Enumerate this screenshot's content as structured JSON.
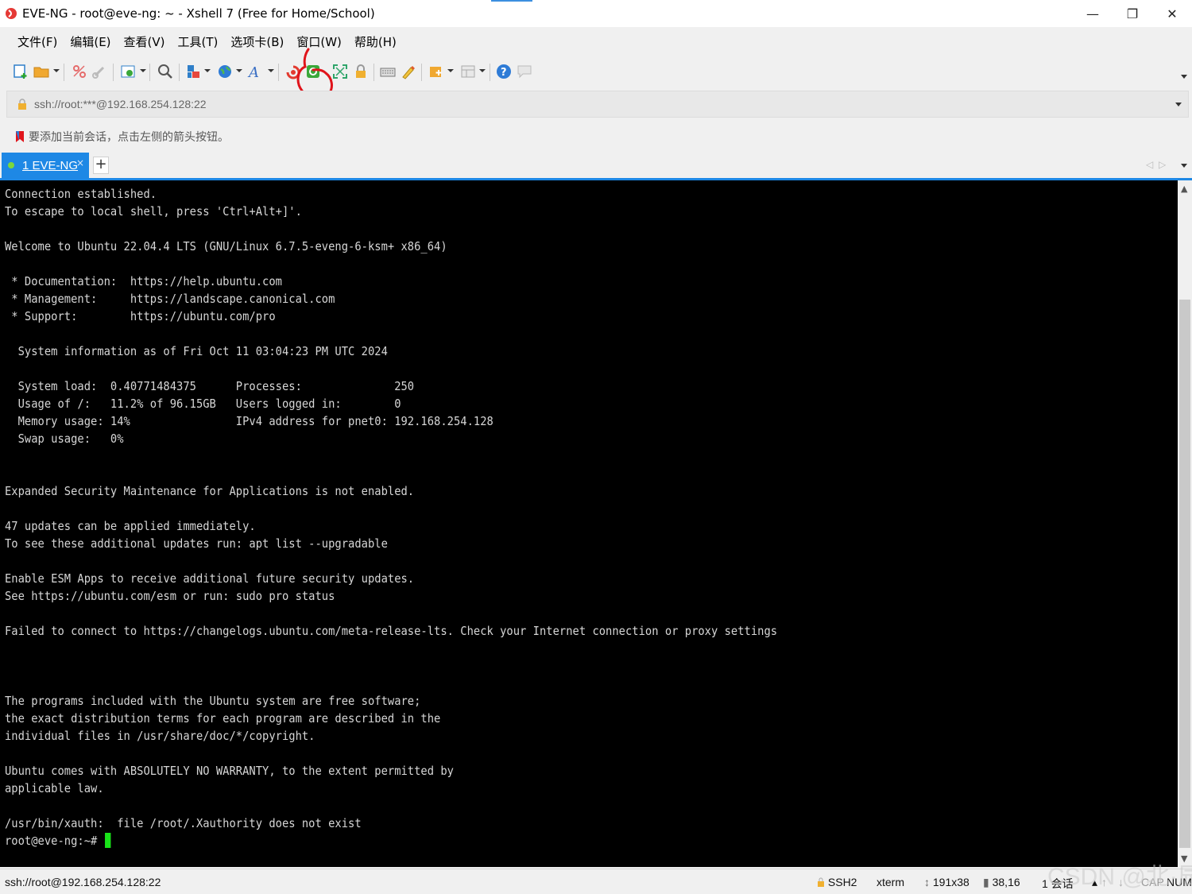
{
  "window": {
    "title": "EVE-NG - root@eve-ng: ~ - Xshell 7 (Free for Home/School)",
    "controls": {
      "minimize": "—",
      "restore": "❐",
      "close": "✕"
    }
  },
  "menu": {
    "items": [
      "文件(F)",
      "编辑(E)",
      "查看(V)",
      "工具(T)",
      "选项卡(B)",
      "窗口(W)",
      "帮助(H)"
    ]
  },
  "address": {
    "value": "ssh://root:***@192.168.254.128:22"
  },
  "hint": {
    "text": "要添加当前会话，点击左侧的箭头按钮。"
  },
  "tabs": {
    "active": {
      "label": "1 EVE-NG",
      "close": "×"
    },
    "add": "+",
    "prev": "◁",
    "next": "▷"
  },
  "terminal": {
    "lines": [
      "Connection established.",
      "To escape to local shell, press 'Ctrl+Alt+]'.",
      "",
      "Welcome to Ubuntu 22.04.4 LTS (GNU/Linux 6.7.5-eveng-6-ksm+ x86_64)",
      "",
      " * Documentation:  https://help.ubuntu.com",
      " * Management:     https://landscape.canonical.com",
      " * Support:        https://ubuntu.com/pro",
      "",
      "  System information as of Fri Oct 11 03:04:23 PM UTC 2024",
      "",
      "  System load:  0.40771484375      Processes:              250",
      "  Usage of /:   11.2% of 96.15GB   Users logged in:        0",
      "  Memory usage: 14%                IPv4 address for pnet0: 192.168.254.128",
      "  Swap usage:   0%",
      "",
      "",
      "Expanded Security Maintenance for Applications is not enabled.",
      "",
      "47 updates can be applied immediately.",
      "To see these additional updates run: apt list --upgradable",
      "",
      "Enable ESM Apps to receive additional future security updates.",
      "See https://ubuntu.com/esm or run: sudo pro status",
      "",
      "Failed to connect to https://changelogs.ubuntu.com/meta-release-lts. Check your Internet connection or proxy settings",
      "",
      "",
      "",
      "The programs included with the Ubuntu system are free software;",
      "the exact distribution terms for each program are described in the",
      "individual files in /usr/share/doc/*/copyright.",
      "",
      "Ubuntu comes with ABSOLUTELY NO WARRANTY, to the extent permitted by",
      "applicable law.",
      "",
      "/usr/bin/xauth:  file /root/.Xauthority does not exist"
    ],
    "prompt": "root@eve-ng:~# "
  },
  "status": {
    "connection": "ssh://root@192.168.254.128:22",
    "protocol": "SSH2",
    "term_type": "xterm",
    "size": "191x38",
    "cursor_pos": "38,16",
    "sessions": "1 会话",
    "cap": "CAP",
    "num": "NUM"
  },
  "watermark": "CSDN @北·辰",
  "colors": {
    "tab_active": "#1e88e5",
    "terminal_bg": "#000000",
    "terminal_fg": "#d6d6d6",
    "cursor": "#19e319",
    "annotation": "#e0141b"
  },
  "icons": [
    "new-session-icon",
    "open-folder-icon",
    "disconnect-icon",
    "reconnect-icon",
    "properties-icon",
    "find-icon",
    "transfer-icon",
    "globe-icon",
    "font-icon",
    "xftp-icon",
    "xmanager-icon",
    "fullscreen-icon",
    "lock-icon",
    "keyboard-icon",
    "highlight-icon",
    "script-icon",
    "layout-icon",
    "help-icon",
    "chat-icon"
  ]
}
